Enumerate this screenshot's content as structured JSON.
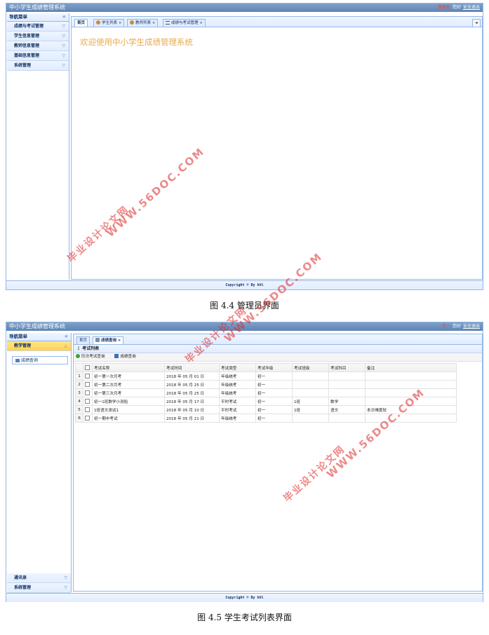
{
  "screen1": {
    "app_title": "中小学生成绩管理系统",
    "user": "管理员",
    "greeting": "您好",
    "logout": "安全退出",
    "nav_title": "导航菜单",
    "nav_collapse": "«",
    "nav_items": [
      "成绩与考试管理",
      "学生信息管理",
      "教师信息管理",
      "基础信息管理",
      "系统管理"
    ],
    "tabs": [
      {
        "label": "首页"
      },
      {
        "label": "学生列表"
      },
      {
        "label": "教师列表"
      },
      {
        "label": "成绩与考试管理"
      }
    ],
    "welcome": "欢迎使用中小学生成绩管理系统",
    "footer": "Copyright © By hhl",
    "caption": "图 4.4  管理员界面"
  },
  "screen2": {
    "app_title": "中小学生成绩管理系统",
    "user": "王一",
    "greeting": "您好",
    "logout": "安全退出",
    "nav_title": "导航菜单",
    "nav_collapse": "«",
    "nav_active": "教学管理",
    "sub_item": "成绩查询",
    "nav_bottom": [
      "通讯录",
      "系统管理"
    ],
    "tabs": [
      {
        "label": "首页"
      },
      {
        "label": "成绩查询"
      }
    ],
    "panel_title": "考试列表",
    "toolbar": [
      "历次考试查询",
      "成绩查询"
    ],
    "columns": [
      "考试名称",
      "考试时间",
      "考试类型",
      "考试年级",
      "考试班级",
      "考试科目",
      "备注"
    ],
    "rows": [
      {
        "n": "1",
        "name": "初一第一次月考",
        "time": "2018 年 05 月 01 日",
        "type": "年级统考",
        "grade": "初一",
        "cls": "",
        "subj": "",
        "note": ""
      },
      {
        "n": "2",
        "name": "初一第二次月考",
        "time": "2018 年 05 月 25 日",
        "type": "年级统考",
        "grade": "初一",
        "cls": "",
        "subj": "",
        "note": ""
      },
      {
        "n": "3",
        "name": "初一第三次月考",
        "time": "2018 年 05 月 25 日",
        "type": "年级统考",
        "grade": "初一",
        "cls": "",
        "subj": "",
        "note": ""
      },
      {
        "n": "4",
        "name": "初一1班数学小测验",
        "time": "2018 年 05 月 17 日",
        "type": "平时考试",
        "grade": "初一",
        "cls": "1班",
        "subj": "数学",
        "note": ""
      },
      {
        "n": "5",
        "name": "1班语文测试1",
        "time": "2018 年 05 月 10 日",
        "type": "平时考试",
        "grade": "初一",
        "cls": "1班",
        "subj": "语文",
        "note": "本次难度较"
      },
      {
        "n": "6",
        "name": "初一期中考试",
        "time": "2018 年 05 月 21 日",
        "type": "年级统考",
        "grade": "初一",
        "cls": "",
        "subj": "",
        "note": ""
      }
    ],
    "footer": "Copyright © By hhl",
    "caption": "图 4.5  学生考试列表界面"
  },
  "watermark": {
    "url": "WWW.56DOC.COM",
    "cn": "毕业设计论文网",
    "color": "#dc2828"
  }
}
